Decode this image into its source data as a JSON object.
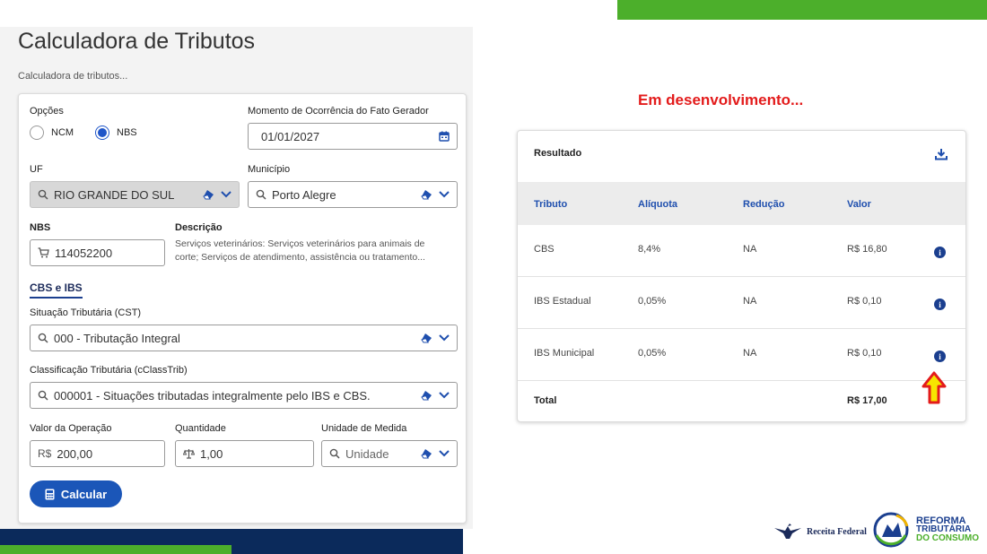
{
  "page": {
    "title": "Calculadora de Tributos",
    "subtitle": "Calculadora de tributos..."
  },
  "form": {
    "opcoes": {
      "label": "Opções",
      "options": [
        {
          "label": "NCM",
          "selected": false
        },
        {
          "label": "NBS",
          "selected": true
        }
      ]
    },
    "momento": {
      "label": "Momento de Ocorrência do Fato Gerador",
      "value": "01/01/2027"
    },
    "uf": {
      "label": "UF",
      "value": "RIO GRANDE DO SUL",
      "disabled": true
    },
    "municipio": {
      "label": "Município",
      "value": "Porto Alegre"
    },
    "nbs": {
      "label": "NBS",
      "value": "114052200"
    },
    "descricao": {
      "label": "Descrição",
      "line1": "Serviços veterinários: Serviços veterinários para animais de",
      "line2": "corte; Serviços de atendimento, assistência ou tratamento..."
    },
    "tab": "CBS e IBS",
    "cst": {
      "label": "Situação Tributária (CST)",
      "value": "000 - Tributação Integral"
    },
    "cclasstrib": {
      "label": "Classificação Tributária (cClassTrib)",
      "value": "000001 - Situações tributadas integralmente pelo IBS e CBS."
    },
    "valor_operacao": {
      "label": "Valor da Operação",
      "prefix": "R$",
      "value": "200,00"
    },
    "quantidade": {
      "label": "Quantidade",
      "value": "1,00"
    },
    "unidade": {
      "label": "Unidade de Medida",
      "placeholder": "Unidade"
    },
    "calcular_label": "Calcular"
  },
  "dev_note": "Em desenvolvimento...",
  "result": {
    "title": "Resultado",
    "headers": {
      "tributo": "Tributo",
      "aliquota": "Alíquota",
      "reducao": "Redução",
      "valor": "Valor"
    },
    "rows": [
      {
        "tributo": "CBS",
        "aliquota": "8,4%",
        "reducao": "NA",
        "valor": "R$ 16,80"
      },
      {
        "tributo": "IBS Estadual",
        "aliquota": "0,05%",
        "reducao": "NA",
        "valor": "R$ 0,10"
      },
      {
        "tributo": "IBS Municipal",
        "aliquota": "0,05%",
        "reducao": "NA",
        "valor": "R$ 0,10"
      }
    ],
    "total_label": "Total",
    "total_value": "R$ 17,00"
  },
  "logos": {
    "receita": "Receita Federal",
    "reforma_line1": "REFORMA",
    "reforma_line2": "TRIBUTÁRIA",
    "reforma_line3": "DO CONSUMO"
  },
  "colors": {
    "accent": "#1b56b8",
    "brand_navy": "#0b2a5b",
    "brand_green": "#4caf2b",
    "dev_note": "#e31b1b",
    "arrow_fill": "#f7e400",
    "arrow_stroke": "#e31b1b"
  },
  "icons": {
    "calendar": "calendar-icon",
    "search": "search-icon",
    "eraser": "eraser-icon",
    "chevron": "chevron-down-icon",
    "cart": "cart-icon",
    "scale": "scale-icon",
    "calculator": "calculator-icon",
    "download": "download-icon",
    "info": "info-icon"
  }
}
